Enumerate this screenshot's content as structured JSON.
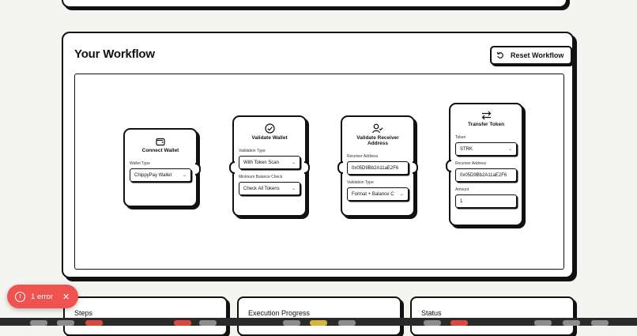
{
  "workflow": {
    "title": "Your Workflow",
    "reset_label": "Reset Workflow"
  },
  "nodes": {
    "connect": {
      "title": "Connect Wallet",
      "wallet_type_label": "Wallet Type",
      "wallet_type_value": "ChippyPay Wallet"
    },
    "validate_wallet": {
      "title": "Validate Wallet",
      "validation_type_label": "Validation Type",
      "validation_type_value": "With Token Scan",
      "min_balance_label": "Minimum Balance Check",
      "min_balance_value": "Check All Tokens"
    },
    "validate_receiver": {
      "title": "Validate Receiver Address",
      "receiver_label": "Receiver Address",
      "receiver_value": "0x05D9Bb2A11aE2F6",
      "validation_type_label": "Validation Type",
      "validation_type_value": "Format + Balance C"
    },
    "transfer": {
      "title": "Transfer Token",
      "token_label": "Token",
      "token_value": "STRK",
      "receiver_label": "Receiver Address",
      "receiver_value": "0x05D9Bb2A11aE2F6",
      "amount_label": "Amount",
      "amount_value": "1"
    }
  },
  "bottom": {
    "steps": "Steps",
    "progress": "Execution Progress",
    "status": "Status"
  },
  "toast": {
    "text": "1 error"
  }
}
